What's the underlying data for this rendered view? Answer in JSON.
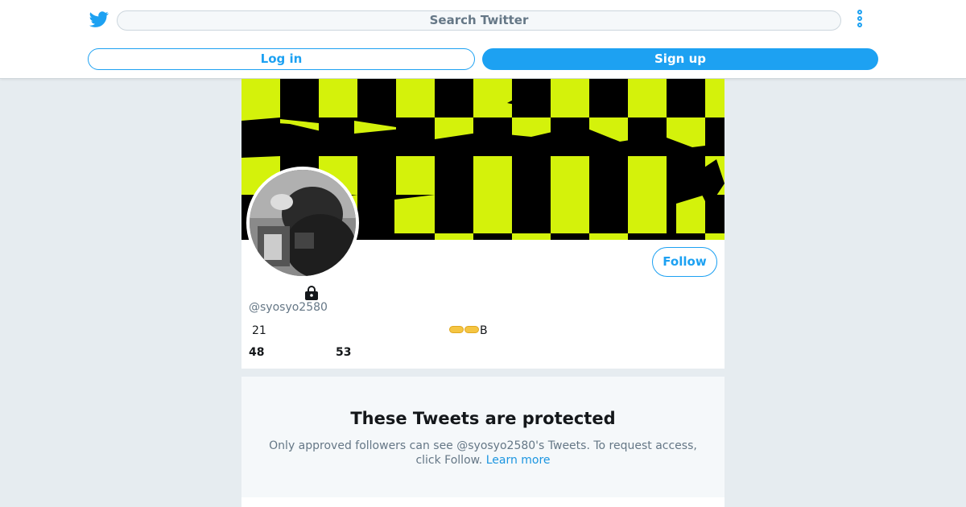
{
  "header": {
    "logo_icon": "twitter-bird-icon",
    "search_placeholder": "Search Twitter",
    "more_icon": "more-vertical-icon",
    "login_label": "Log in",
    "signup_label": "Sign up",
    "brand_color": "#1da1f2"
  },
  "profile": {
    "follow_label": "Follow",
    "lock_icon": "lock-icon",
    "handle": "@syosyo2580",
    "bio_number": "21",
    "bio_suffix": "B",
    "stats": {
      "following_count": "48",
      "followers_count": "53"
    },
    "banner_colors": [
      "#000000",
      "#d4f20b"
    ]
  },
  "protected": {
    "title": "These Tweets are protected",
    "message": "Only approved followers can see @syosyo2580's Tweets. To request access, click Follow.",
    "learn_more": "Learn more"
  }
}
